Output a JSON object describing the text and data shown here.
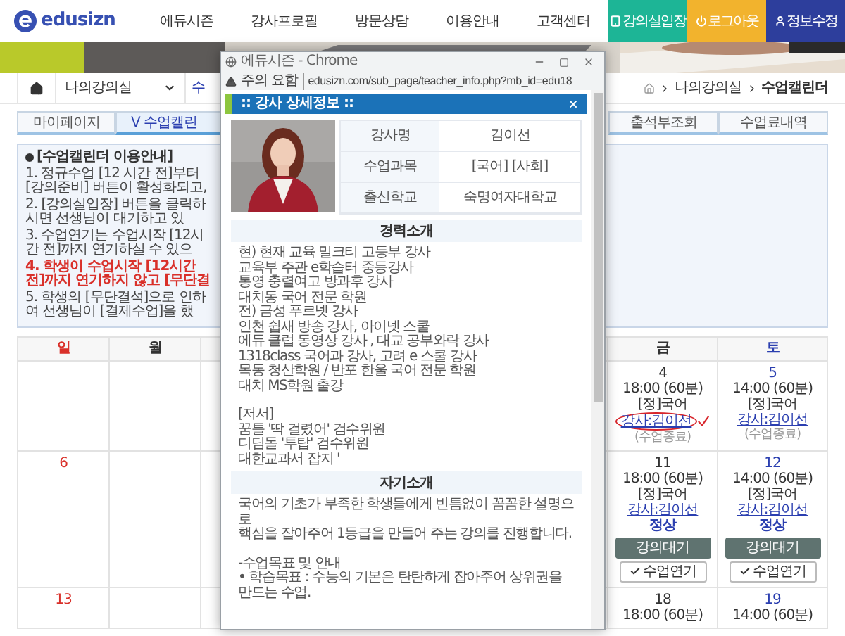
{
  "header": {
    "logo": "edusizn",
    "nav": [
      "에듀시즌",
      "강사프로필",
      "방문상담",
      "이용안내",
      "고객센터"
    ],
    "actions": [
      {
        "label": "강의실입장",
        "kind": "enter"
      },
      {
        "label": "로그아웃",
        "kind": "logout"
      },
      {
        "label": "정보수정",
        "kind": "profile"
      }
    ]
  },
  "subnav": {
    "section": "나의강의실",
    "next": "수",
    "breadcrumb": [
      "나의강의실",
      "수업캘린더"
    ]
  },
  "tabs_left": [
    {
      "label": "마이페이지",
      "selected": false
    },
    {
      "label": "V 수업캘린",
      "selected": true
    }
  ],
  "tabs_right": [
    {
      "label": "출석부조회",
      "selected": false
    },
    {
      "label": "수업료내역",
      "selected": false
    }
  ],
  "notice": {
    "title": "[수업캘린더 이용안내]",
    "lines": [
      {
        "text": "1. 정규수업 [12 시간 전]부터 [강의준비] 버튼이 활성화되고,",
        "kind": "normal"
      },
      {
        "text": "2. [강의실입장] 버튼을 클릭하시면 선생님이 대기하고 있",
        "kind": "normal"
      },
      {
        "text": "3. 수업연기는 수업시작 [12시간 전]까지 연기하실 수 있으",
        "kind": "normal"
      },
      {
        "text": "4. 학생이 수업시작 [12시간 전]까지 연기하지 않고 [무단결",
        "kind": "warning"
      },
      {
        "text": "5. 학생의 [무단결석]으로 인하여 선생님이 [결제수업]을 했",
        "kind": "normal"
      }
    ]
  },
  "calendar": {
    "columns": [
      {
        "label": "일",
        "kind": "sun"
      },
      {
        "label": "월",
        "kind": "weekday"
      },
      {
        "label": "금",
        "kind": "weekday"
      },
      {
        "label": "토",
        "kind": "sat"
      }
    ],
    "weeks": [
      [
        {
          "kind": "blank"
        },
        {
          "kind": "blank"
        },
        {
          "kind": "day",
          "date": "4",
          "time": "18:00 (60분)",
          "subject": "[정]국어",
          "teacher": "강사:김이선",
          "circled": true,
          "status": "(수업종료)",
          "finished": true
        },
        {
          "kind": "day",
          "date": "5",
          "time": "14:00 (60분)",
          "subject": "[정]국어",
          "teacher": "강사:김이선",
          "circled": false,
          "status": "(수업종료)",
          "finished": true
        }
      ],
      [
        {
          "kind": "day",
          "date": "6"
        },
        {
          "kind": "blank"
        },
        {
          "kind": "day",
          "date": "11",
          "time": "18:00 (60분)",
          "subject": "[정]국어",
          "teacher": "강사:김이선",
          "circled": false,
          "status": "정상",
          "finished": false,
          "buttons": [
            {
              "label": "강의대기",
              "kind": "wait"
            },
            {
              "label": "수업연기",
              "kind": "postpone"
            }
          ]
        },
        {
          "kind": "day",
          "date": "12",
          "time": "14:00 (60분)",
          "subject": "[정]국어",
          "teacher": "강사:김이선",
          "circled": false,
          "status": "정상",
          "finished": false,
          "buttons": [
            {
              "label": "강의대기",
              "kind": "wait"
            },
            {
              "label": "수업연기",
              "kind": "postpone"
            }
          ]
        }
      ],
      [
        {
          "kind": "day",
          "date": "13"
        },
        {
          "kind": "blank"
        },
        {
          "kind": "day",
          "date": "18",
          "time": "18:00 (60분)"
        },
        {
          "kind": "day",
          "date": "19",
          "time": "14:00 (60분)"
        }
      ]
    ]
  },
  "popup": {
    "window_title": "에듀시즌 - Chrome",
    "warning": "주의 요함",
    "url": "edusizn.com/sub_page/teacher_info.php?mb_id=edu18",
    "heading": ":: 강사 상세정보 ::",
    "profile": [
      {
        "label": "강사명",
        "value": "김이선"
      },
      {
        "label": "수업과목",
        "value": "[국어] [사회]"
      },
      {
        "label": "출신학교",
        "value": "숙명여자대학교"
      }
    ],
    "sections": [
      {
        "title": "경력소개",
        "paragraphs": [
          [
            "현) 현재 교육 밀크티 고등부 강사",
            "교육부 주관 e학습터 중등강사",
            "통영 충렬여고 방과후 강사",
            "대치동 국어 전문 학원",
            "전) 금성 푸르넷 강사",
            "인천 쉽새 방송 강사, 아이넷 스쿨",
            "에듀 클럽 동영상 강사 , 대교 공부와락 강사",
            "1318class 국어과 강사, 고려 e 스쿨 강사",
            "목동 청산학원 / 반포 한울 국어 전문 학원",
            "대치 MS학원 출강"
          ],
          [
            "[저서]",
            "꿈틀 '딱 걸렸어' 검수위원",
            "디딤돌 '투탑' 검수위원",
            "대한교과서 잡지 '"
          ]
        ]
      },
      {
        "title": "자기소개",
        "paragraphs": [
          [
            "국어의 기초가 부족한 학생들에게 빈틈없이 꼼꼼한 설명으로",
            "핵심을 잡아주어 1등급을 만들어 주는 강의를 진행합니다."
          ],
          [
            "-수업목표 및 안내",
            "• 학습목표 : 수능의 기본은 탄탄하게 잡아주어 상위권을 만드는 수업."
          ]
        ]
      }
    ]
  }
}
